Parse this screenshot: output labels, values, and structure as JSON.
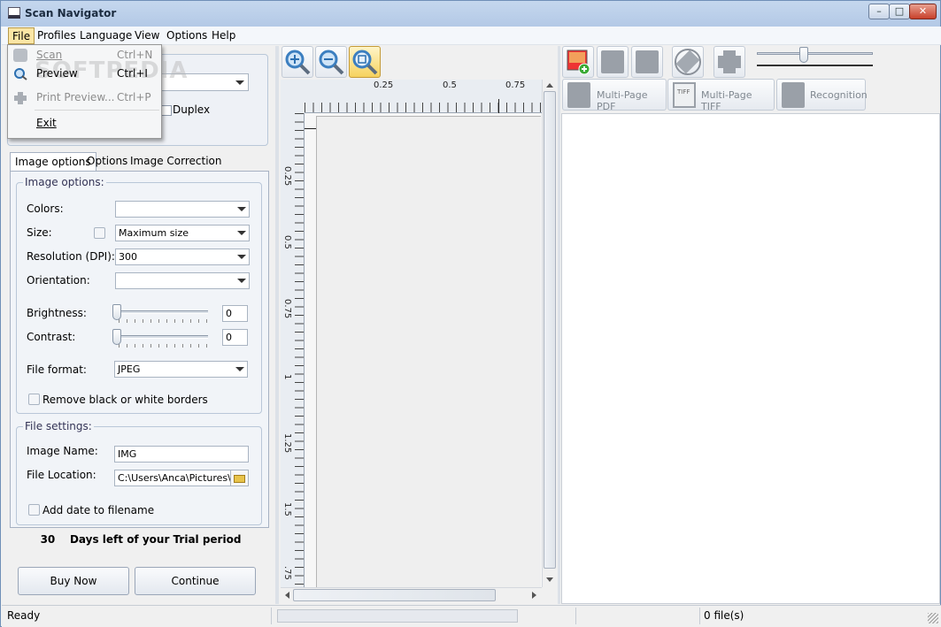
{
  "window": {
    "title": "Scan Navigator",
    "min": "–",
    "max": "□",
    "close": "✕"
  },
  "menubar": [
    "File",
    "Profiles",
    "Language",
    "View",
    "Options",
    "Help"
  ],
  "file_menu": {
    "items": [
      {
        "label": "Scan",
        "shortcut": "Ctrl+N",
        "enabled": false,
        "icon": "scanner-icon"
      },
      {
        "label": "Preview",
        "shortcut": "Ctrl+I",
        "enabled": true,
        "icon": "preview-icon"
      },
      {
        "label": "Print Preview...",
        "shortcut": "Ctrl+P",
        "enabled": false,
        "icon": "print-preview-icon"
      },
      {
        "label": "Exit",
        "shortcut": "",
        "enabled": true,
        "icon": ""
      }
    ],
    "watermark": "SOFTPEDIA"
  },
  "source": {
    "duplex_label": "Duplex",
    "selected": ""
  },
  "tabs": [
    "Image options",
    "Options",
    "Image Correction"
  ],
  "image_options": {
    "legend": "Image options:",
    "colors_label": "Colors:",
    "colors_value": "",
    "size_label": "Size:",
    "size_value": "Maximum size",
    "resolution_label": "Resolution (DPI):",
    "resolution_value": "300",
    "orientation_label": "Orientation:",
    "orientation_value": "",
    "brightness_label": "Brightness:",
    "brightness_value": "0",
    "contrast_label": "Contrast:",
    "contrast_value": "0",
    "format_label": "File format:",
    "format_value": "JPEG",
    "remove_borders_label": "Remove black or white borders"
  },
  "file_settings": {
    "legend": "File settings:",
    "name_label": "Image Name:",
    "name_value": "IMG",
    "location_label": "File Location:",
    "location_value": "C:\\Users\\Anca\\Pictures\\Sc",
    "add_date_label": "Add date to filename"
  },
  "trial": {
    "text": "30    Days left of your Trial period"
  },
  "buttons": {
    "buy": "Buy Now",
    "continue": "Continue"
  },
  "ruler": {
    "top": [
      "0.25",
      "0.5",
      "0.75"
    ],
    "left": [
      "0.25",
      "0.5",
      "0.75",
      "1",
      "1.25",
      "1.5",
      ".75"
    ]
  },
  "right_toolbar": {
    "multipage_pdf": "Multi-Page PDF",
    "multipage_tiff": "Multi-Page TIFF",
    "recognition": "Recognition",
    "tiff_badge": "TIFF"
  },
  "status": {
    "left": "Ready",
    "files": "0 file(s)"
  },
  "colors": {
    "accent": "#fbe6a5",
    "titlebar": "#b3c9e6"
  }
}
